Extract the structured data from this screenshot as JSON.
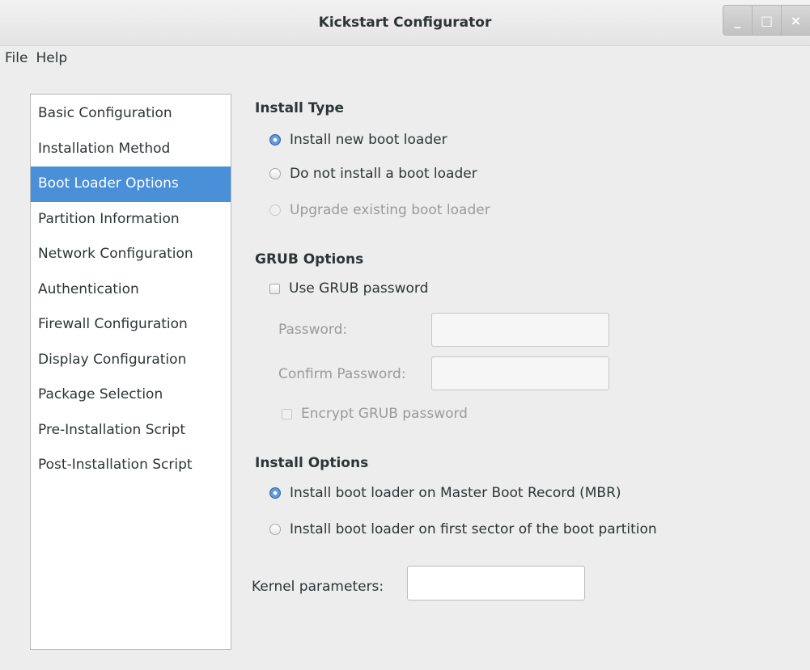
{
  "window": {
    "title": "Kickstart Configurator",
    "controls": [
      "_",
      "□",
      "×"
    ]
  },
  "menubar": {
    "items": [
      "File",
      "Help"
    ]
  },
  "sidebar": {
    "items": [
      {
        "label": "Basic Configuration",
        "selected": false
      },
      {
        "label": "Installation Method",
        "selected": false
      },
      {
        "label": "Boot Loader Options",
        "selected": true
      },
      {
        "label": "Partition Information",
        "selected": false
      },
      {
        "label": "Network Configuration",
        "selected": false
      },
      {
        "label": "Authentication",
        "selected": false
      },
      {
        "label": "Firewall Configuration",
        "selected": false
      },
      {
        "label": "Display Configuration",
        "selected": false
      },
      {
        "label": "Package Selection",
        "selected": false
      },
      {
        "label": "Pre-Installation Script",
        "selected": false
      },
      {
        "label": "Post-Installation Script",
        "selected": false
      }
    ]
  },
  "install_type": {
    "heading": "Install Type",
    "options": [
      {
        "label": "Install new boot loader",
        "checked": true,
        "enabled": true
      },
      {
        "label": "Do not install a boot loader",
        "checked": false,
        "enabled": true
      },
      {
        "label": "Upgrade existing boot loader",
        "checked": false,
        "enabled": false
      }
    ]
  },
  "grub_options": {
    "heading": "GRUB Options",
    "use_password_label": "Use GRUB password",
    "use_password_checked": false,
    "password_label": "Password:",
    "password_value": "",
    "confirm_label": "Confirm Password:",
    "confirm_value": "",
    "encrypt_label": "Encrypt GRUB password",
    "encrypt_checked": false
  },
  "install_options": {
    "heading": "Install Options",
    "options": [
      {
        "label": "Install boot loader on Master Boot Record (MBR)",
        "checked": true
      },
      {
        "label": "Install boot loader on first sector of the boot partition",
        "checked": false
      }
    ]
  },
  "kernel": {
    "label": "Kernel parameters:",
    "value": ""
  },
  "colors": {
    "selection": "#4a90d9",
    "background": "#ededed",
    "disabled_text": "#9a9a9a"
  }
}
